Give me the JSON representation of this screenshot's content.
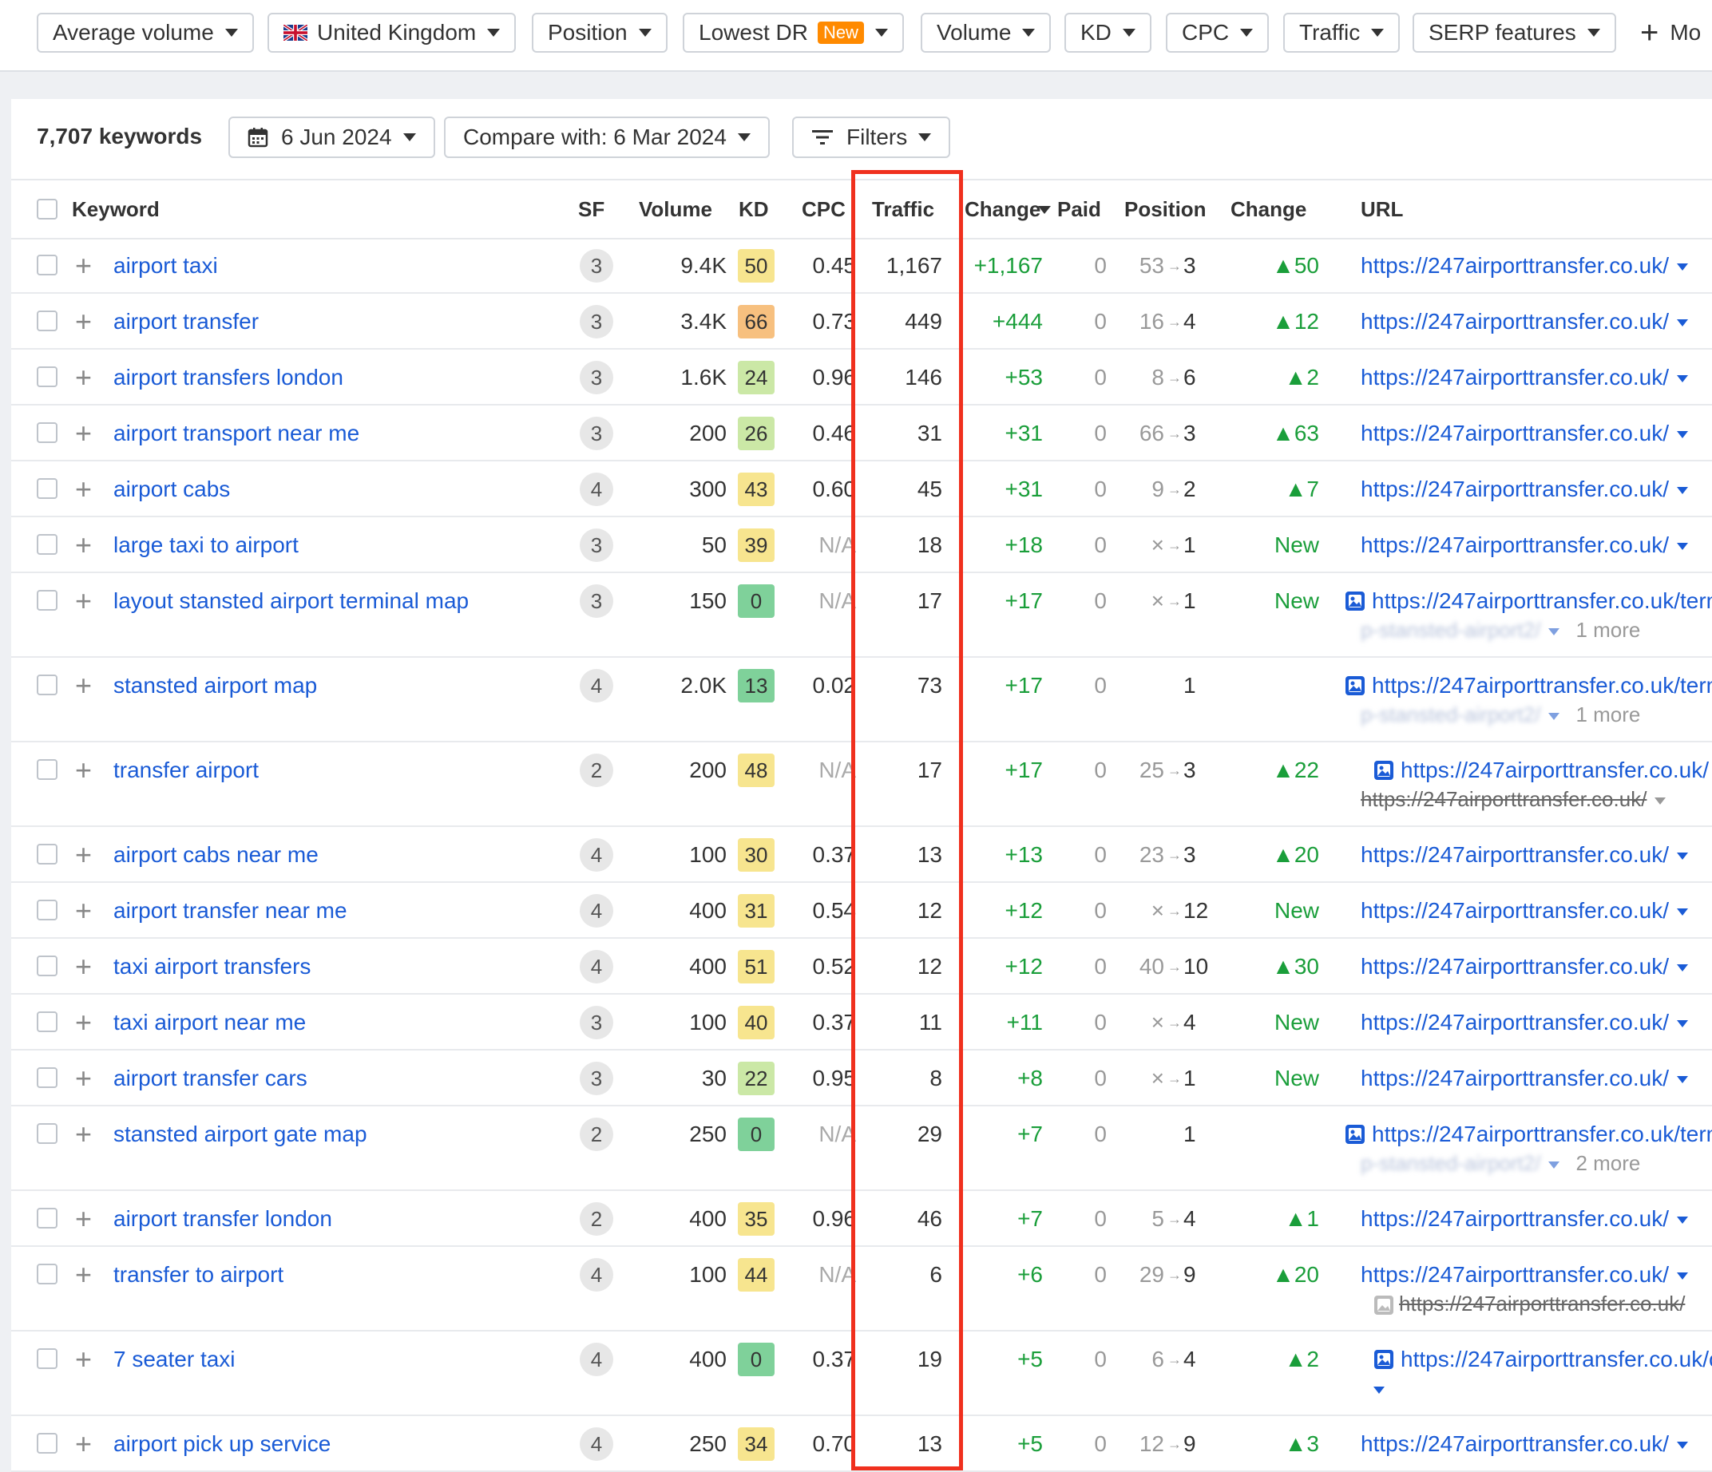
{
  "filters": {
    "average_volume": "Average volume",
    "country": "United Kingdom",
    "position": "Position",
    "lowest_dr": "Lowest DR",
    "new_badge": "New",
    "volume": "Volume",
    "kd": "KD",
    "cpc": "CPC",
    "traffic": "Traffic",
    "serp_features": "SERP features",
    "more": "Mo"
  },
  "summary": {
    "count": "7,707 keywords",
    "date": "6 Jun 2024",
    "compare": "Compare with: 6 Mar 2024",
    "filters": "Filters"
  },
  "columns": {
    "keyword": "Keyword",
    "sf": "SF",
    "volume": "Volume",
    "kd": "KD",
    "cpc": "CPC",
    "traffic": "Traffic",
    "change": "Change",
    "paid": "Paid",
    "position": "Position",
    "pos_change": "Change",
    "url": "URL"
  },
  "colors": {
    "kd_green": "#7fd19a",
    "kd_lightgreen": "#cbe8a6",
    "kd_yellow": "#f7e58f",
    "kd_orange": "#f7c07f",
    "accent": "#1a5bd6",
    "positive": "#1a9e3a",
    "highlight": "#f0301e"
  },
  "rows": [
    {
      "keyword": "airport taxi",
      "sf": "3",
      "volume": "9.4K",
      "kd": "50",
      "kd_color": "yellow",
      "cpc": "0.45",
      "traffic": "1,167",
      "change": "+1,167",
      "paid": "0",
      "pos_from": "53",
      "pos_to": "3",
      "pos_change": "▲50",
      "url": "https://247airporttransfer.co.uk/",
      "url_sub": "",
      "url_icon": "",
      "sub_prefix": ""
    },
    {
      "keyword": "airport transfer",
      "sf": "3",
      "volume": "3.4K",
      "kd": "66",
      "kd_color": "orange",
      "cpc": "0.73",
      "traffic": "449",
      "change": "+444",
      "paid": "0",
      "pos_from": "16",
      "pos_to": "4",
      "pos_change": "▲12",
      "url": "https://247airporttransfer.co.uk/",
      "url_sub": "",
      "url_icon": "",
      "sub_prefix": ""
    },
    {
      "keyword": "airport transfers london",
      "sf": "3",
      "volume": "1.6K",
      "kd": "24",
      "kd_color": "lightgreen",
      "cpc": "0.96",
      "traffic": "146",
      "change": "+53",
      "paid": "0",
      "pos_from": "8",
      "pos_to": "6",
      "pos_change": "▲2",
      "url": "https://247airporttransfer.co.uk/",
      "url_sub": "",
      "url_icon": "",
      "sub_prefix": ""
    },
    {
      "keyword": "airport transport near me",
      "sf": "3",
      "volume": "200",
      "kd": "26",
      "kd_color": "lightgreen",
      "cpc": "0.46",
      "traffic": "31",
      "change": "+31",
      "paid": "0",
      "pos_from": "66",
      "pos_to": "3",
      "pos_change": "▲63",
      "url": "https://247airporttransfer.co.uk/",
      "url_sub": "",
      "url_icon": "",
      "sub_prefix": ""
    },
    {
      "keyword": "airport cabs",
      "sf": "4",
      "volume": "300",
      "kd": "43",
      "kd_color": "yellow",
      "cpc": "0.60",
      "traffic": "45",
      "change": "+31",
      "paid": "0",
      "pos_from": "9",
      "pos_to": "2",
      "pos_change": "▲7",
      "url": "https://247airporttransfer.co.uk/",
      "url_sub": "",
      "url_icon": "",
      "sub_prefix": ""
    },
    {
      "keyword": "large taxi to airport",
      "sf": "3",
      "volume": "50",
      "kd": "39",
      "kd_color": "yellow",
      "cpc": "N/A",
      "traffic": "18",
      "change": "+18",
      "paid": "0",
      "pos_from": "×",
      "pos_to": "1",
      "pos_change": "New",
      "url": "https://247airporttransfer.co.uk/",
      "url_sub": "",
      "url_icon": "",
      "sub_prefix": ""
    },
    {
      "keyword": "layout stansted airport terminal map",
      "sf": "3",
      "volume": "150",
      "kd": "0",
      "kd_color": "green",
      "cpc": "N/A",
      "traffic": "17",
      "change": "+17",
      "paid": "0",
      "pos_from": "×",
      "pos_to": "1",
      "pos_change": "New",
      "url": "https://247airporttransfer.co.uk/term",
      "url_sub": "1 more",
      "url_icon": "image",
      "sub_prefix": "p-stansted-airport2/"
    },
    {
      "keyword": "stansted airport map",
      "sf": "4",
      "volume": "2.0K",
      "kd": "13",
      "kd_color": "green",
      "cpc": "0.02",
      "traffic": "73",
      "change": "+17",
      "paid": "0",
      "pos_from": "",
      "pos_to": "1",
      "pos_change": "",
      "url": "https://247airporttransfer.co.uk/term",
      "url_sub": "1 more",
      "url_icon": "image",
      "sub_prefix": "p-stansted-airport2/"
    },
    {
      "keyword": "transfer airport",
      "sf": "2",
      "volume": "200",
      "kd": "48",
      "kd_color": "yellow",
      "cpc": "N/A",
      "traffic": "17",
      "change": "+17",
      "paid": "0",
      "pos_from": "25",
      "pos_to": "3",
      "pos_change": "▲22",
      "url": "https://247airporttransfer.co.uk/",
      "url_sub": "https://247airporttransfer.co.uk/",
      "url_icon": "image",
      "sub_prefix": "strike"
    },
    {
      "keyword": "airport cabs near me",
      "sf": "4",
      "volume": "100",
      "kd": "30",
      "kd_color": "yellow",
      "cpc": "0.37",
      "traffic": "13",
      "change": "+13",
      "paid": "0",
      "pos_from": "23",
      "pos_to": "3",
      "pos_change": "▲20",
      "url": "https://247airporttransfer.co.uk/",
      "url_sub": "",
      "url_icon": "",
      "sub_prefix": ""
    },
    {
      "keyword": "airport transfer near me",
      "sf": "4",
      "volume": "400",
      "kd": "31",
      "kd_color": "yellow",
      "cpc": "0.54",
      "traffic": "12",
      "change": "+12",
      "paid": "0",
      "pos_from": "×",
      "pos_to": "12",
      "pos_change": "New",
      "url": "https://247airporttransfer.co.uk/",
      "url_sub": "",
      "url_icon": "",
      "sub_prefix": ""
    },
    {
      "keyword": "taxi airport transfers",
      "sf": "4",
      "volume": "400",
      "kd": "51",
      "kd_color": "yellow",
      "cpc": "0.52",
      "traffic": "12",
      "change": "+12",
      "paid": "0",
      "pos_from": "40",
      "pos_to": "10",
      "pos_change": "▲30",
      "url": "https://247airporttransfer.co.uk/",
      "url_sub": "",
      "url_icon": "",
      "sub_prefix": ""
    },
    {
      "keyword": "taxi airport near me",
      "sf": "3",
      "volume": "100",
      "kd": "40",
      "kd_color": "yellow",
      "cpc": "0.37",
      "traffic": "11",
      "change": "+11",
      "paid": "0",
      "pos_from": "×",
      "pos_to": "4",
      "pos_change": "New",
      "url": "https://247airporttransfer.co.uk/",
      "url_sub": "",
      "url_icon": "",
      "sub_prefix": ""
    },
    {
      "keyword": "airport transfer cars",
      "sf": "3",
      "volume": "30",
      "kd": "22",
      "kd_color": "lightgreen",
      "cpc": "0.95",
      "traffic": "8",
      "change": "+8",
      "paid": "0",
      "pos_from": "×",
      "pos_to": "1",
      "pos_change": "New",
      "url": "https://247airporttransfer.co.uk/",
      "url_sub": "",
      "url_icon": "",
      "sub_prefix": ""
    },
    {
      "keyword": "stansted airport gate map",
      "sf": "2",
      "volume": "250",
      "kd": "0",
      "kd_color": "green",
      "cpc": "N/A",
      "traffic": "29",
      "change": "+7",
      "paid": "0",
      "pos_from": "",
      "pos_to": "1",
      "pos_change": "",
      "url": "https://247airporttransfer.co.uk/term",
      "url_sub": "2 more",
      "url_icon": "image",
      "sub_prefix": "p-stansted-airport2/"
    },
    {
      "keyword": "airport transfer london",
      "sf": "2",
      "volume": "400",
      "kd": "35",
      "kd_color": "yellow",
      "cpc": "0.96",
      "traffic": "46",
      "change": "+7",
      "paid": "0",
      "pos_from": "5",
      "pos_to": "4",
      "pos_change": "▲1",
      "url": "https://247airporttransfer.co.uk/",
      "url_sub": "",
      "url_icon": "",
      "sub_prefix": ""
    },
    {
      "keyword": "transfer to airport",
      "sf": "4",
      "volume": "100",
      "kd": "44",
      "kd_color": "yellow",
      "cpc": "N/A",
      "traffic": "6",
      "change": "+6",
      "paid": "0",
      "pos_from": "29",
      "pos_to": "9",
      "pos_change": "▲20",
      "url": "https://247airporttransfer.co.uk/",
      "url_sub": "https://247airporttransfer.co.uk/",
      "url_icon": "",
      "sub_prefix": "strike-img"
    },
    {
      "keyword": "7 seater taxi",
      "sf": "4",
      "volume": "400",
      "kd": "0",
      "kd_color": "green",
      "cpc": "0.37",
      "traffic": "19",
      "change": "+5",
      "paid": "0",
      "pos_from": "6",
      "pos_to": "4",
      "pos_change": "▲2",
      "url": "https://247airporttransfer.co.uk/c",
      "url_sub": "",
      "url_icon": "image",
      "sub_prefix": "caret-only"
    },
    {
      "keyword": "airport pick up service",
      "sf": "4",
      "volume": "250",
      "kd": "34",
      "kd_color": "yellow",
      "cpc": "0.70",
      "traffic": "13",
      "change": "+5",
      "paid": "0",
      "pos_from": "12",
      "pos_to": "9",
      "pos_change": "▲3",
      "url": "https://247airporttransfer.co.uk/",
      "url_sub": "",
      "url_icon": "",
      "sub_prefix": ""
    }
  ]
}
